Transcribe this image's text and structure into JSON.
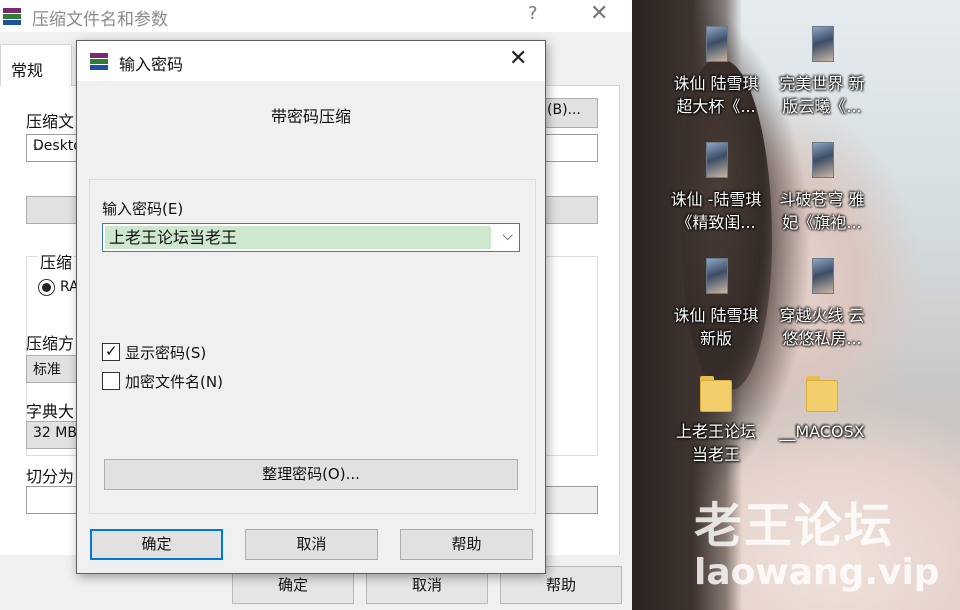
{
  "background_window": {
    "title": "压缩文件名和参数",
    "help_glyph": "?",
    "close_glyph": "✕",
    "tab_general": "常规",
    "archive_name_label": "压缩文",
    "archive_name_value": "Deskto",
    "browse_button_tail": "(B)...",
    "format_group_label": "压缩",
    "format_radio_label": "RA",
    "method_label": "压缩方",
    "method_value": "标准",
    "dict_label": "字典大",
    "dict_value": "32 MB",
    "split_label": "切分为",
    "buttons": {
      "ok": "确定",
      "cancel": "取消",
      "help": "帮助"
    }
  },
  "dialog": {
    "title": "输入密码",
    "close_glyph": "✕",
    "heading": "带密码压缩",
    "password_label": "输入密码(E)",
    "password_value": "上老王论坛当老王",
    "show_password_label": "显示密码(S)",
    "show_password_checked": true,
    "encrypt_names_label": "加密文件名(N)",
    "encrypt_names_checked": false,
    "manage_button": "整理密码(O)...",
    "buttons": {
      "ok": "确定",
      "cancel": "取消",
      "help": "帮助"
    }
  },
  "desktop": {
    "icons": [
      {
        "label_line1": "诛仙  陆雪琪",
        "label_line2": "超大杯《...",
        "type": "file-icon"
      },
      {
        "label_line1": "完美世界 新",
        "label_line2": "版云曦《...",
        "type": "file-icon"
      },
      {
        "label_line1": "诛仙 -陆雪琪",
        "label_line2": "《精致闺...",
        "type": "file-icon"
      },
      {
        "label_line1": "斗破苍穹 雅",
        "label_line2": "妃《旗袍...",
        "type": "file-icon"
      },
      {
        "label_line1": "诛仙 陆雪琪",
        "label_line2": "新版",
        "type": "file-icon"
      },
      {
        "label_line1": "穿越火线 云",
        "label_line2": "悠悠私房...",
        "type": "file-icon"
      },
      {
        "label_line1": "上老王论坛",
        "label_line2": "当老王",
        "type": "folder-icon"
      },
      {
        "label_line1": "__MACOSX",
        "label_line2": "",
        "type": "folder-icon"
      }
    ],
    "watermark_cn": "老王论坛",
    "watermark_url": "laowang.vip"
  },
  "colors": {
    "accent": "#0078d7",
    "password_highlight": "#cde8cf",
    "folder": "#f2cf6a"
  }
}
